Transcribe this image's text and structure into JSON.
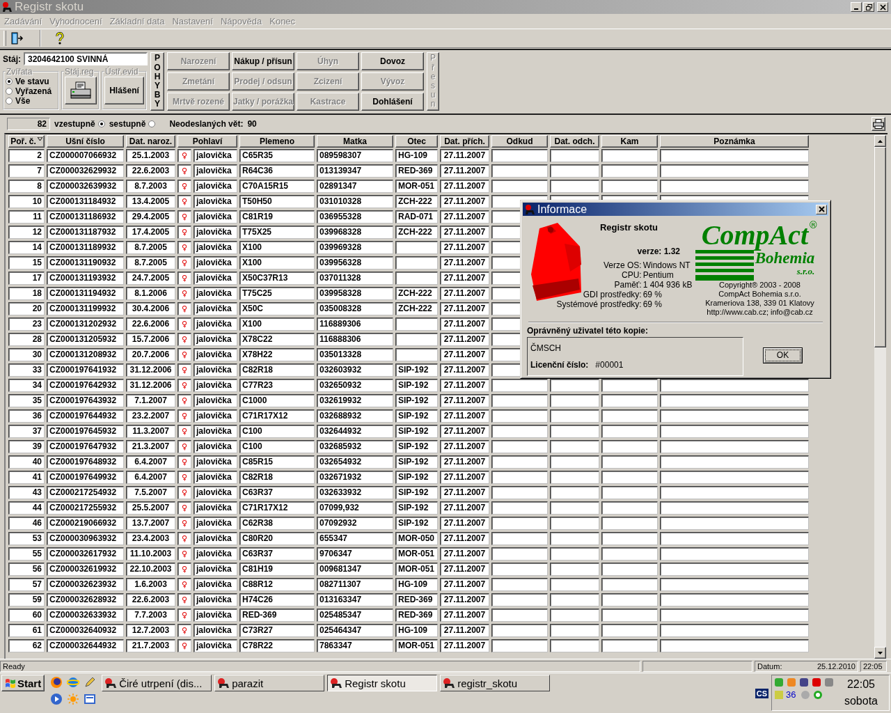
{
  "window": {
    "title": "Registr skotu"
  },
  "menu": [
    {
      "label": "Zadávání",
      "disabled": true
    },
    {
      "label": "Vyhodnocení",
      "disabled": true
    },
    {
      "label": "Základní data",
      "disabled": true
    },
    {
      "label": "Nastavení",
      "disabled": true
    },
    {
      "label": "Nápověda",
      "disabled": true
    },
    {
      "label": "Konec",
      "disabled": true
    }
  ],
  "stable": {
    "label": "Stáj:",
    "value": "3204642100 SVINNÁ"
  },
  "animals_group": {
    "title": "Zvířata",
    "options": [
      {
        "label": "Ve stavu",
        "selected": true
      },
      {
        "label": "Vyřazená",
        "selected": false
      },
      {
        "label": "Vše",
        "selected": false
      }
    ]
  },
  "stable_reg_group": {
    "title": "Stáj.reg"
  },
  "central_reg_group": {
    "title": "Ústř.evid",
    "button": "Hlášení"
  },
  "movements_label": "POHYBY",
  "movement_buttons": [
    {
      "label": "Narození",
      "disabled": true
    },
    {
      "label": "Nákup / přísun",
      "disabled": false
    },
    {
      "label": "Úhyn",
      "disabled": true
    },
    {
      "label": "Dovoz",
      "disabled": false
    },
    {
      "label": "Zmetání",
      "disabled": true
    },
    {
      "label": "Prodej / odsun",
      "disabled": true
    },
    {
      "label": "Zcizení",
      "disabled": true
    },
    {
      "label": "Vývoz",
      "disabled": true
    },
    {
      "label": "Mrtvě rozené",
      "disabled": true
    },
    {
      "label": "Jatky / porážka",
      "disabled": true
    },
    {
      "label": "Kastrace",
      "disabled": true
    },
    {
      "label": "Dohlášení",
      "disabled": false
    }
  ],
  "transfer_button": {
    "label": "Přesun",
    "disabled": true
  },
  "filter": {
    "count": "82",
    "sort": [
      {
        "label": "vzestupně",
        "selected": true
      },
      {
        "label": "sestupně",
        "selected": false
      }
    ],
    "unsent_label": "Neodeslaných vět:",
    "unsent_value": "90"
  },
  "table": {
    "columns": [
      "Poř. č.",
      "Ušní číslo",
      "Dat. naroz.",
      "Pohlaví",
      "Plemeno",
      "Matka",
      "Otec",
      "Dat. přích.",
      "Odkud",
      "Dat. odch.",
      "Kam",
      "Poznámka"
    ],
    "rows": [
      {
        "no": "2",
        "ear_tag": "CZ000007066932",
        "birth_date": "25.1.2003",
        "sex": "♀",
        "sex_label": "jalovička",
        "breed": "C65R35",
        "mother": "089598307",
        "father": "HG-109",
        "arrival_date": "27.11.2007"
      },
      {
        "no": "7",
        "ear_tag": "CZ000032629932",
        "birth_date": "22.6.2003",
        "sex": "♀",
        "sex_label": "jalovička",
        "breed": "R64C36",
        "mother": "013139347",
        "father": "RED-369",
        "arrival_date": "27.11.2007"
      },
      {
        "no": "8",
        "ear_tag": "CZ000032639932",
        "birth_date": "8.7.2003",
        "sex": "♀",
        "sex_label": "jalovička",
        "breed": "C70A15R15",
        "mother": "02891347",
        "father": "MOR-051",
        "arrival_date": "27.11.2007"
      },
      {
        "no": "10",
        "ear_tag": "CZ000131184932",
        "birth_date": "13.4.2005",
        "sex": "♀",
        "sex_label": "jalovička",
        "breed": "T50H50",
        "mother": "031010328",
        "father": "ZCH-222",
        "arrival_date": "27.11.2007"
      },
      {
        "no": "11",
        "ear_tag": "CZ000131186932",
        "birth_date": "29.4.2005",
        "sex": "♀",
        "sex_label": "jalovička",
        "breed": "C81R19",
        "mother": "036955328",
        "father": "RAD-071",
        "arrival_date": "27.11.2007"
      },
      {
        "no": "12",
        "ear_tag": "CZ000131187932",
        "birth_date": "17.4.2005",
        "sex": "♀",
        "sex_label": "jalovička",
        "breed": "T75X25",
        "mother": "039968328",
        "father": "ZCH-222",
        "arrival_date": "27.11.2007"
      },
      {
        "no": "14",
        "ear_tag": "CZ000131189932",
        "birth_date": "8.7.2005",
        "sex": "♀",
        "sex_label": "jalovička",
        "breed": "X100",
        "mother": "039969328",
        "arrival_date": "27.11.2007"
      },
      {
        "no": "15",
        "ear_tag": "CZ000131190932",
        "birth_date": "8.7.2005",
        "sex": "♀",
        "sex_label": "jalovička",
        "breed": "X100",
        "mother": "039956328",
        "arrival_date": "27.11.2007"
      },
      {
        "no": "17",
        "ear_tag": "CZ000131193932",
        "birth_date": "24.7.2005",
        "sex": "♀",
        "sex_label": "jalovička",
        "breed": "X50C37R13",
        "mother": "037011328",
        "arrival_date": "27.11.2007"
      },
      {
        "no": "18",
        "ear_tag": "CZ000131194932",
        "birth_date": "8.1.2006",
        "sex": "♀",
        "sex_label": "jalovička",
        "breed": "T75C25",
        "mother": "039958328",
        "father": "ZCH-222",
        "arrival_date": "27.11.2007"
      },
      {
        "no": "20",
        "ear_tag": "CZ000131199932",
        "birth_date": "30.4.2006",
        "sex": "♀",
        "sex_label": "jalovička",
        "breed": "X50C",
        "mother": "035008328",
        "father": "ZCH-222",
        "arrival_date": "27.11.2007"
      },
      {
        "no": "23",
        "ear_tag": "CZ000131202932",
        "birth_date": "22.6.2006",
        "sex": "♀",
        "sex_label": "jalovička",
        "breed": "X100",
        "mother": "116889306",
        "arrival_date": "27.11.2007"
      },
      {
        "no": "28",
        "ear_tag": "CZ000131205932",
        "birth_date": "15.7.2006",
        "sex": "♀",
        "sex_label": "jalovička",
        "breed": "X78C22",
        "mother": "116888306",
        "arrival_date": "27.11.2007"
      },
      {
        "no": "30",
        "ear_tag": "CZ000131208932",
        "birth_date": "20.7.2006",
        "sex": "♀",
        "sex_label": "jalovička",
        "breed": "X78H22",
        "mother": "035013328",
        "arrival_date": "27.11.2007"
      },
      {
        "no": "33",
        "ear_tag": "CZ000197641932",
        "birth_date": "31.12.2006",
        "sex": "♀",
        "sex_label": "jalovička",
        "breed": "C82R18",
        "mother": "032603932",
        "father": "SIP-192",
        "arrival_date": "27.11.2007"
      },
      {
        "no": "34",
        "ear_tag": "CZ000197642932",
        "birth_date": "31.12.2006",
        "sex": "♀",
        "sex_label": "jalovička",
        "breed": "C77R23",
        "mother": "032650932",
        "father": "SIP-192",
        "arrival_date": "27.11.2007"
      },
      {
        "no": "35",
        "ear_tag": "CZ000197643932",
        "birth_date": "7.1.2007",
        "sex": "♀",
        "sex_label": "jalovička",
        "breed": "C1000",
        "mother": "032619932",
        "father": "SIP-192",
        "arrival_date": "27.11.2007"
      },
      {
        "no": "36",
        "ear_tag": "CZ000197644932",
        "birth_date": "23.2.2007",
        "sex": "♀",
        "sex_label": "jalovička",
        "breed": "C71R17X12",
        "mother": "032688932",
        "father": "SIP-192",
        "arrival_date": "27.11.2007"
      },
      {
        "no": "37",
        "ear_tag": "CZ000197645932",
        "birth_date": "11.3.2007",
        "sex": "♀",
        "sex_label": "jalovička",
        "breed": "C100",
        "mother": "032644932",
        "father": "SIP-192",
        "arrival_date": "27.11.2007"
      },
      {
        "no": "39",
        "ear_tag": "CZ000197647932",
        "birth_date": "21.3.2007",
        "sex": "♀",
        "sex_label": "jalovička",
        "breed": "C100",
        "mother": "032685932",
        "father": "SIP-192",
        "arrival_date": "27.11.2007"
      },
      {
        "no": "40",
        "ear_tag": "CZ000197648932",
        "birth_date": "6.4.2007",
        "sex": "♀",
        "sex_label": "jalovička",
        "breed": "C85R15",
        "mother": "032654932",
        "father": "SIP-192",
        "arrival_date": "27.11.2007"
      },
      {
        "no": "41",
        "ear_tag": "CZ000197649932",
        "birth_date": "6.4.2007",
        "sex": "♀",
        "sex_label": "jalovička",
        "breed": "C82R18",
        "mother": "032671932",
        "father": "SIP-192",
        "arrival_date": "27.11.2007"
      },
      {
        "no": "43",
        "ear_tag": "CZ000217254932",
        "birth_date": "7.5.2007",
        "sex": "♀",
        "sex_label": "jalovička",
        "breed": "C63R37",
        "mother": "032633932",
        "father": "SIP-192",
        "arrival_date": "27.11.2007"
      },
      {
        "no": "44",
        "ear_tag": "CZ000217255932",
        "birth_date": "25.5.2007",
        "sex": "♀",
        "sex_label": "jalovička",
        "breed": "C71R17X12",
        "mother": "07099,932",
        "father": "SIP-192",
        "arrival_date": "27.11.2007"
      },
      {
        "no": "46",
        "ear_tag": "CZ000219066932",
        "birth_date": "13.7.2007",
        "sex": "♀",
        "sex_label": "jalovička",
        "breed": "C62R38",
        "mother": "07092932",
        "father": "SIP-192",
        "arrival_date": "27.11.2007"
      },
      {
        "no": "53",
        "ear_tag": "CZ000030963932",
        "birth_date": "23.4.2003",
        "sex": "♀",
        "sex_label": "jalovička",
        "breed": "C80R20",
        "mother": "655347",
        "father": "MOR-050",
        "arrival_date": "27.11.2007"
      },
      {
        "no": "55",
        "ear_tag": "CZ000032617932",
        "birth_date": "11.10.2003",
        "sex": "♀",
        "sex_label": "jalovička",
        "breed": "C63R37",
        "mother": "9706347",
        "father": "MOR-051",
        "arrival_date": "27.11.2007"
      },
      {
        "no": "56",
        "ear_tag": "CZ000032619932",
        "birth_date": "22.10.2003",
        "sex": "♀",
        "sex_label": "jalovička",
        "breed": "C81H19",
        "mother": "009681347",
        "father": "MOR-051",
        "arrival_date": "27.11.2007"
      },
      {
        "no": "57",
        "ear_tag": "CZ000032623932",
        "birth_date": "1.6.2003",
        "sex": "♀",
        "sex_label": "jalovička",
        "breed": "C88R12",
        "mother": "082711307",
        "father": "HG-109",
        "arrival_date": "27.11.2007"
      },
      {
        "no": "59",
        "ear_tag": "CZ000032628932",
        "birth_date": "22.6.2003",
        "sex": "♀",
        "sex_label": "jalovička",
        "breed": "H74C26",
        "mother": "013163347",
        "father": "RED-369",
        "arrival_date": "27.11.2007"
      },
      {
        "no": "60",
        "ear_tag": "CZ000032633932",
        "birth_date": "7.7.2003",
        "sex": "♀",
        "sex_label": "jalovička",
        "breed": "RED-369",
        "mother": "025485347",
        "father": "RED-369",
        "arrival_date": "27.11.2007"
      },
      {
        "no": "61",
        "ear_tag": "CZ000032640932",
        "birth_date": "12.7.2003",
        "sex": "♀",
        "sex_label": "jalovička",
        "breed": "C73R27",
        "mother": "025464347",
        "father": "HG-109",
        "arrival_date": "27.11.2007"
      },
      {
        "no": "62",
        "ear_tag": "CZ000032644932",
        "birth_date": "21.7.2003",
        "sex": "♀",
        "sex_label": "jalovička",
        "breed": "C78R22",
        "mother": "7863347",
        "father": "MOR-051",
        "arrival_date": "27.11.2007"
      }
    ]
  },
  "dialog": {
    "title": "Informace",
    "app_name": "Registr skotu",
    "version": "verze: 1.32",
    "system_info": [
      {
        "label": "Verze OS:",
        "value": "Windows NT"
      },
      {
        "label": "CPU:",
        "value": "Pentium"
      },
      {
        "label": "Paměť:",
        "value": "1 404 936 kB"
      },
      {
        "label": "GDI prostředky:",
        "value": "69 %"
      },
      {
        "label": "Systémové prostředky:",
        "value": "69 %"
      }
    ],
    "logo": {
      "name": "CompAct",
      "mark": "®",
      "sub": "Bohemia",
      "suffix": "s.r.o."
    },
    "copyright": [
      "Copyright® 2003 - 2008",
      "CompAct Bohemia s.r.o.",
      "Krameriova 138, 339 01 Klatovy",
      "http://www.cab.cz; info@cab.cz"
    ],
    "user_label": "Oprávněný uživatel této kopie:",
    "user": "ČMSCH",
    "license_label": "Licenční číslo:",
    "license": "#00001",
    "ok": "OK"
  },
  "status_bar": {
    "text": "Ready",
    "date_label": "Datum:",
    "date": "25.12.2010",
    "time": "22:05"
  },
  "taskbar": {
    "start": "Start",
    "tasks": [
      {
        "label": "Čiré utrpení (dis...",
        "selected": false
      },
      {
        "label": "parazit",
        "selected": false
      },
      {
        "label": "Registr skotu",
        "selected": true
      },
      {
        "label": "registr_skotu",
        "selected": false
      }
    ],
    "language": "CS",
    "tray_number": "36",
    "clock": "22:05",
    "day": "sobota"
  }
}
